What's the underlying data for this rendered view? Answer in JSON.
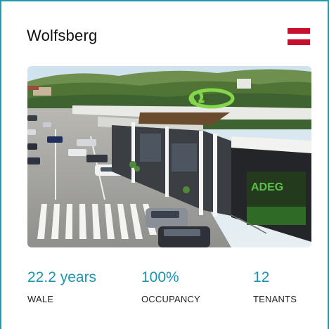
{
  "card": {
    "title": "Wolfsberg",
    "flag": {
      "icon": "austria-flag-icon",
      "colors": [
        "#c8102e",
        "#ffffff",
        "#c8102e"
      ]
    },
    "photo_sign_text": "ADEG",
    "stats": [
      {
        "value": "22.2 years",
        "label": "WALE"
      },
      {
        "value": "100%",
        "label": "OCCUPANCY"
      },
      {
        "value": "12",
        "label": "TENANTS"
      }
    ]
  },
  "colors": {
    "accent": "#1b93b2",
    "border": "#1e9bb0"
  }
}
